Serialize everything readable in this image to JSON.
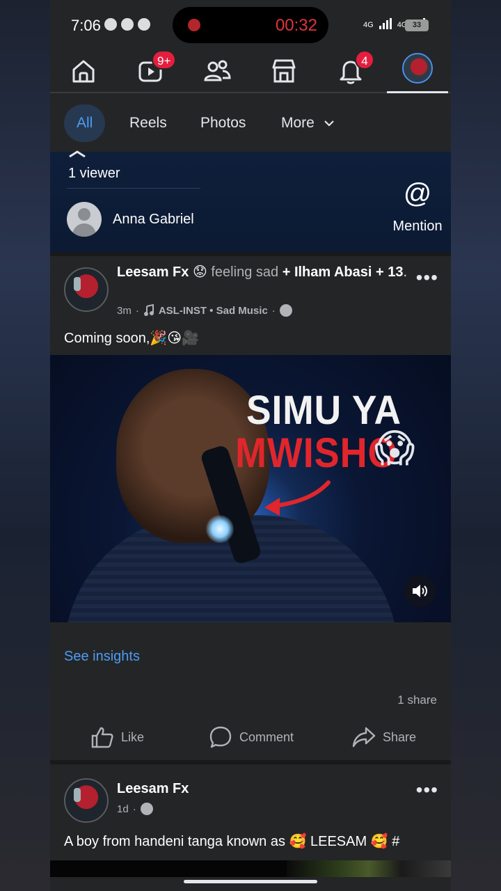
{
  "status_bar": {
    "time": "7:06",
    "recording_timer": "00:32",
    "network_1": "4G",
    "network_2": "4G",
    "battery": "33"
  },
  "nav": {
    "items": [
      {
        "name": "home",
        "icon": "home-icon"
      },
      {
        "name": "video",
        "icon": "video-icon",
        "badge": "9+"
      },
      {
        "name": "friends",
        "icon": "friends-icon"
      },
      {
        "name": "marketplace",
        "icon": "marketplace-icon"
      },
      {
        "name": "notifications",
        "icon": "bell-icon",
        "badge": "4"
      },
      {
        "name": "profile",
        "icon": "avatar"
      }
    ]
  },
  "filters": {
    "all": "All",
    "reels": "Reels",
    "photos": "Photos",
    "more": "More"
  },
  "viewers": {
    "count": "1 viewer",
    "viewer_name": "Anna Gabriel",
    "mention_symbol": "@",
    "mention_label": "Mention"
  },
  "post1": {
    "author": "Leesam Fx",
    "feeling_emoji": "😟",
    "feeling": "feeling sad",
    "with_plus": "+",
    "tagged": "Ilham Abasi",
    "others": "+ 13",
    "period": ".",
    "time": "3m",
    "music": "ASL-INST • Sad Music",
    "text": "Coming soon,🎉😘🎥",
    "media_title_1": "SIMU YA",
    "media_title_2": "MWISHO",
    "media_emoji": "😱",
    "insights": "See insights",
    "share_count": "1 share",
    "actions": {
      "like": "Like",
      "comment": "Comment",
      "share": "Share"
    }
  },
  "post2": {
    "author": "Leesam Fx",
    "time": "1d",
    "text": "A boy from handeni tanga known as 🥰 LEESAM 🥰 #"
  },
  "colors": {
    "background": "#242526",
    "accent": "#4d9cf5",
    "badge": "#e41e3f",
    "record": "#e0343a"
  }
}
